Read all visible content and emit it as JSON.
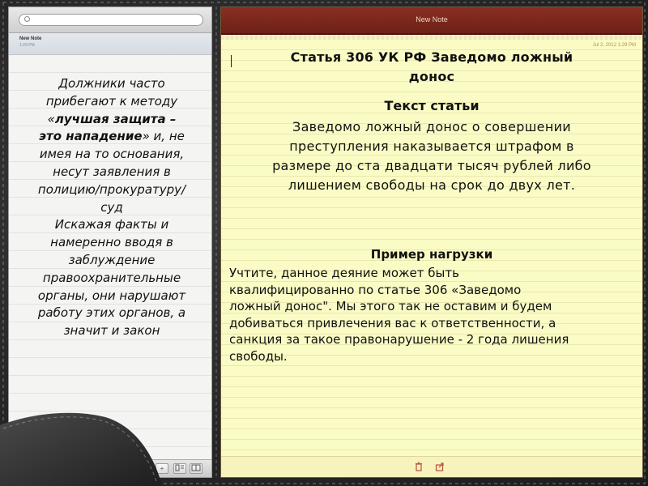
{
  "window": {
    "title": "New Note"
  },
  "search": {
    "placeholder": "",
    "value": ""
  },
  "notes_list": {
    "items": [
      {
        "title": "New Note",
        "time": "1:29 PM"
      }
    ],
    "text_lines": [
      {
        "text": "Должники часто",
        "bold": false
      },
      {
        "text": "прибегают к методу",
        "bold": false
      },
      {
        "parts": [
          {
            "text": "«",
            "bold": false
          },
          {
            "text": "лучшая защита –",
            "bold": true
          }
        ]
      },
      {
        "parts": [
          {
            "text": "это нападение",
            "bold": true
          },
          {
            "text": "» и, не",
            "bold": false
          }
        ]
      },
      {
        "text": "имея на то основания,",
        "bold": false
      },
      {
        "text": "несут заявления в",
        "bold": false
      },
      {
        "text": "полицию/прокуратуру/",
        "bold": false
      },
      {
        "text": "суд",
        "bold": false
      },
      {
        "text": "Искажая факты и",
        "bold": false
      },
      {
        "text": "намеренно вводя в",
        "bold": false
      },
      {
        "text": "заблуждение",
        "bold": false
      },
      {
        "text": "правоохранительные",
        "bold": false
      },
      {
        "text": "органы, они нарушают",
        "bold": false
      },
      {
        "text": "работу этих органов, а",
        "bold": false
      },
      {
        "text": "значит и закон",
        "bold": false
      }
    ],
    "footer": {
      "add_label": "+",
      "btn2_label": "",
      "btn3_label": ""
    }
  },
  "note": {
    "date": "Jul 2, 2012 1:29 PM",
    "title_line1": "Статья 306 УК РФ Заведомо ложный",
    "title_line2": "донос",
    "section1": {
      "heading": "Текст статьи",
      "lines": [
        "Заведомо ложный донос о совершении",
        "преступления наказывается штрафом в",
        "размере до ста двадцати тысяч рублей  либо",
        "лишением свободы на срок до двух лет."
      ]
    },
    "section2": {
      "heading": "Пример нагрузки",
      "lines": [
        "Учтите, данное деяние может быть",
        "квалифицированно по статье 306 «Заведомо",
        "ложный донос\". Мы этого так не оставим и будем",
        "добиваться привлечения вас к ответственности, а",
        "санкция за такое правонарушение - 2 года лишения",
        "свободы."
      ]
    }
  },
  "colors": {
    "header_bar": "#7b271b",
    "paper": "#fbfcc5",
    "leather": "#2b2b2b",
    "date_text": "#b08c62"
  },
  "icons": [
    "search-icon",
    "trash-icon",
    "share-icon",
    "add-icon"
  ]
}
